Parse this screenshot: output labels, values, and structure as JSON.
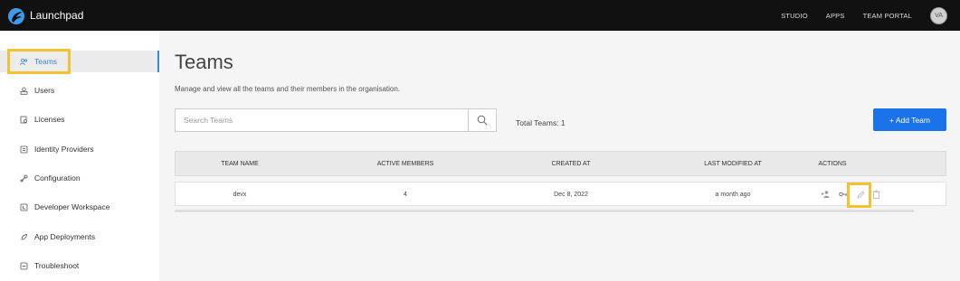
{
  "header": {
    "brand": "Launchpad",
    "nav": [
      "STUDIO",
      "APPS",
      "TEAM PORTAL"
    ],
    "avatar_initials": "VA"
  },
  "sidebar": {
    "items": [
      {
        "label": "Teams",
        "icon": "teams-icon",
        "active": true
      },
      {
        "label": "Users",
        "icon": "users-icon"
      },
      {
        "label": "Licenses",
        "icon": "licenses-icon"
      },
      {
        "label": "Identity Providers",
        "icon": "identity-icon"
      },
      {
        "label": "Configuration",
        "icon": "configuration-icon"
      },
      {
        "label": "Developer Workspace",
        "icon": "workspace-icon"
      },
      {
        "label": "App Deployments",
        "icon": "deployments-icon"
      },
      {
        "label": "Troubleshoot",
        "icon": "troubleshoot-icon"
      }
    ]
  },
  "main": {
    "title": "Teams",
    "subtitle": "Manage and view all the teams and their members in the organisation.",
    "search_placeholder": "Search Teams",
    "total": "Total Teams: 1",
    "add_button": "+ Add Team"
  },
  "table": {
    "columns": [
      "TEAM NAME",
      "ACTIVE MEMBERS",
      "CREATED AT",
      "LAST MODIFIED AT",
      "ACTIONS"
    ],
    "rows": [
      {
        "name": "devx",
        "members": "4",
        "created": "Dec 8, 2022",
        "modified": "a month ago"
      }
    ]
  },
  "colors": {
    "accent": "#1a73e8",
    "highlight": "#f1c232",
    "topbar": "#111111"
  }
}
